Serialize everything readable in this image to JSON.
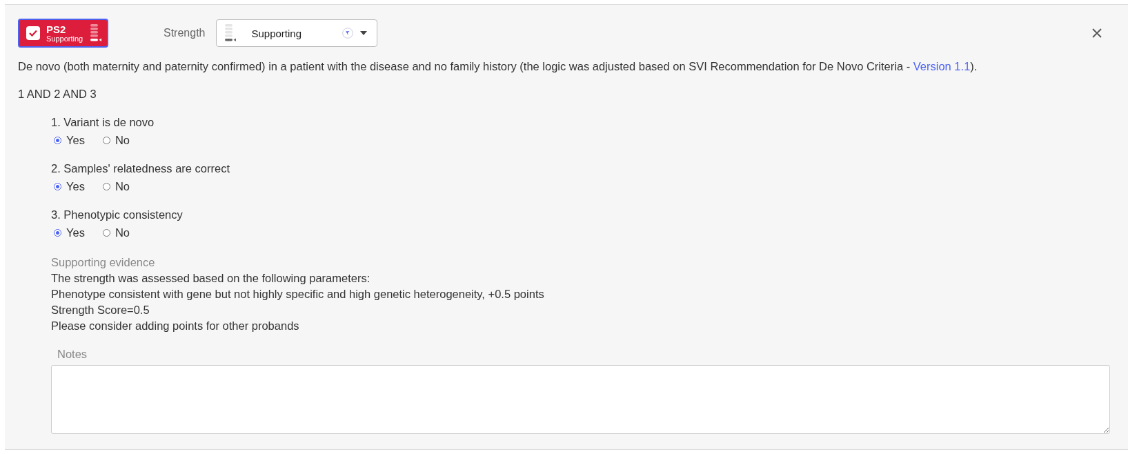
{
  "criterion": {
    "code": "PS2",
    "strength": "Supporting",
    "checked": true
  },
  "strength_field": {
    "label": "Strength",
    "value": "Supporting"
  },
  "description": {
    "text_before": "De novo (both maternity and paternity confirmed) in a patient with the disease and no family history (the logic was adjusted based on SVI Recommendation for De Novo Criteria - ",
    "link": "Version 1.1",
    "text_after": ")."
  },
  "logic": "1 AND 2 AND 3",
  "questions": [
    {
      "label": "1. Variant is de novo",
      "options": [
        {
          "label": "Yes",
          "selected": true
        },
        {
          "label": "No",
          "selected": false
        }
      ]
    },
    {
      "label": "2. Samples' relatedness are correct",
      "options": [
        {
          "label": "Yes",
          "selected": true
        },
        {
          "label": "No",
          "selected": false
        }
      ]
    },
    {
      "label": "3. Phenotypic consistency",
      "options": [
        {
          "label": "Yes",
          "selected": true
        },
        {
          "label": "No",
          "selected": false
        }
      ]
    }
  ],
  "evidence": {
    "title": "Supporting evidence",
    "lines": [
      "The strength was assessed based on the following parameters:",
      "Phenotype consistent with gene but not highly specific and high genetic heterogeneity, +0.5 points",
      "Strength Score=0.5",
      "Please consider adding points for other probands"
    ]
  },
  "notes": {
    "label": "Notes"
  }
}
